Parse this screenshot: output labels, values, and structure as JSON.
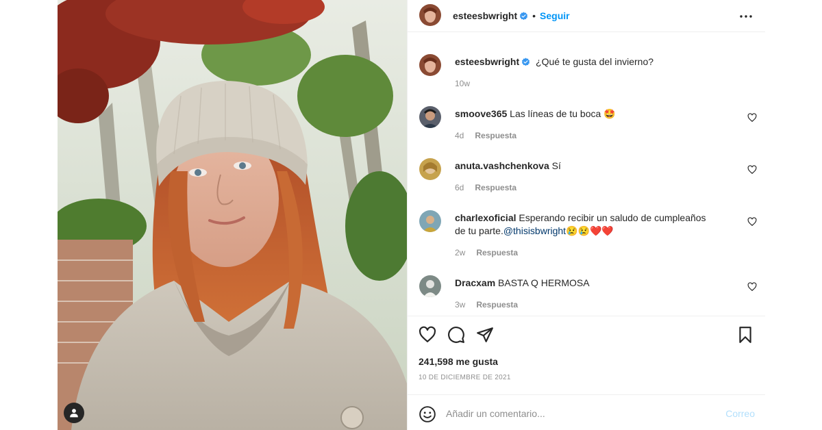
{
  "post": {
    "author": "esteesbwright",
    "follow_label": "Seguir",
    "separator": "•",
    "caption": "¿Qué te gusta del invierno?",
    "caption_time": "10w"
  },
  "comments": [
    {
      "user": "smoove365",
      "text": " Las líneas de tu boca 🤩",
      "time": "4d",
      "reply": "Respuesta"
    },
    {
      "user": "anuta.vashchenkova",
      "text": " Sí",
      "time": "6d",
      "reply": "Respuesta"
    },
    {
      "user": "charlexoficial",
      "text": " Esperando recibir un saludo de cumpleaños de tu parte.",
      "mention": "@thisisbwright",
      "emoji_tail": "😢😢❤️❤️",
      "time": "2w",
      "reply": "Respuesta"
    },
    {
      "user": "Dracxam",
      "text": " BASTA Q HERMOSA",
      "time": "3w",
      "reply": "Respuesta"
    }
  ],
  "likes": "241,598 me gusta",
  "date": "10 DE DICIEMBRE DE 2021",
  "add_comment": {
    "placeholder": "Añadir un comentario...",
    "post_label": "Correo"
  },
  "icons": {
    "header_more": "more-horizontal-icon",
    "verified": "verified-badge-icon",
    "like": "heart-icon",
    "comment": "comment-bubble-icon",
    "share": "paper-plane-icon",
    "save": "bookmark-icon",
    "emoji": "smiley-icon",
    "tag": "user-tag-icon"
  },
  "colors": {
    "accent": "#0095f6",
    "verified": "#3897f0",
    "muted": "#8e8e8e",
    "post_disabled": "#b2dffc"
  }
}
